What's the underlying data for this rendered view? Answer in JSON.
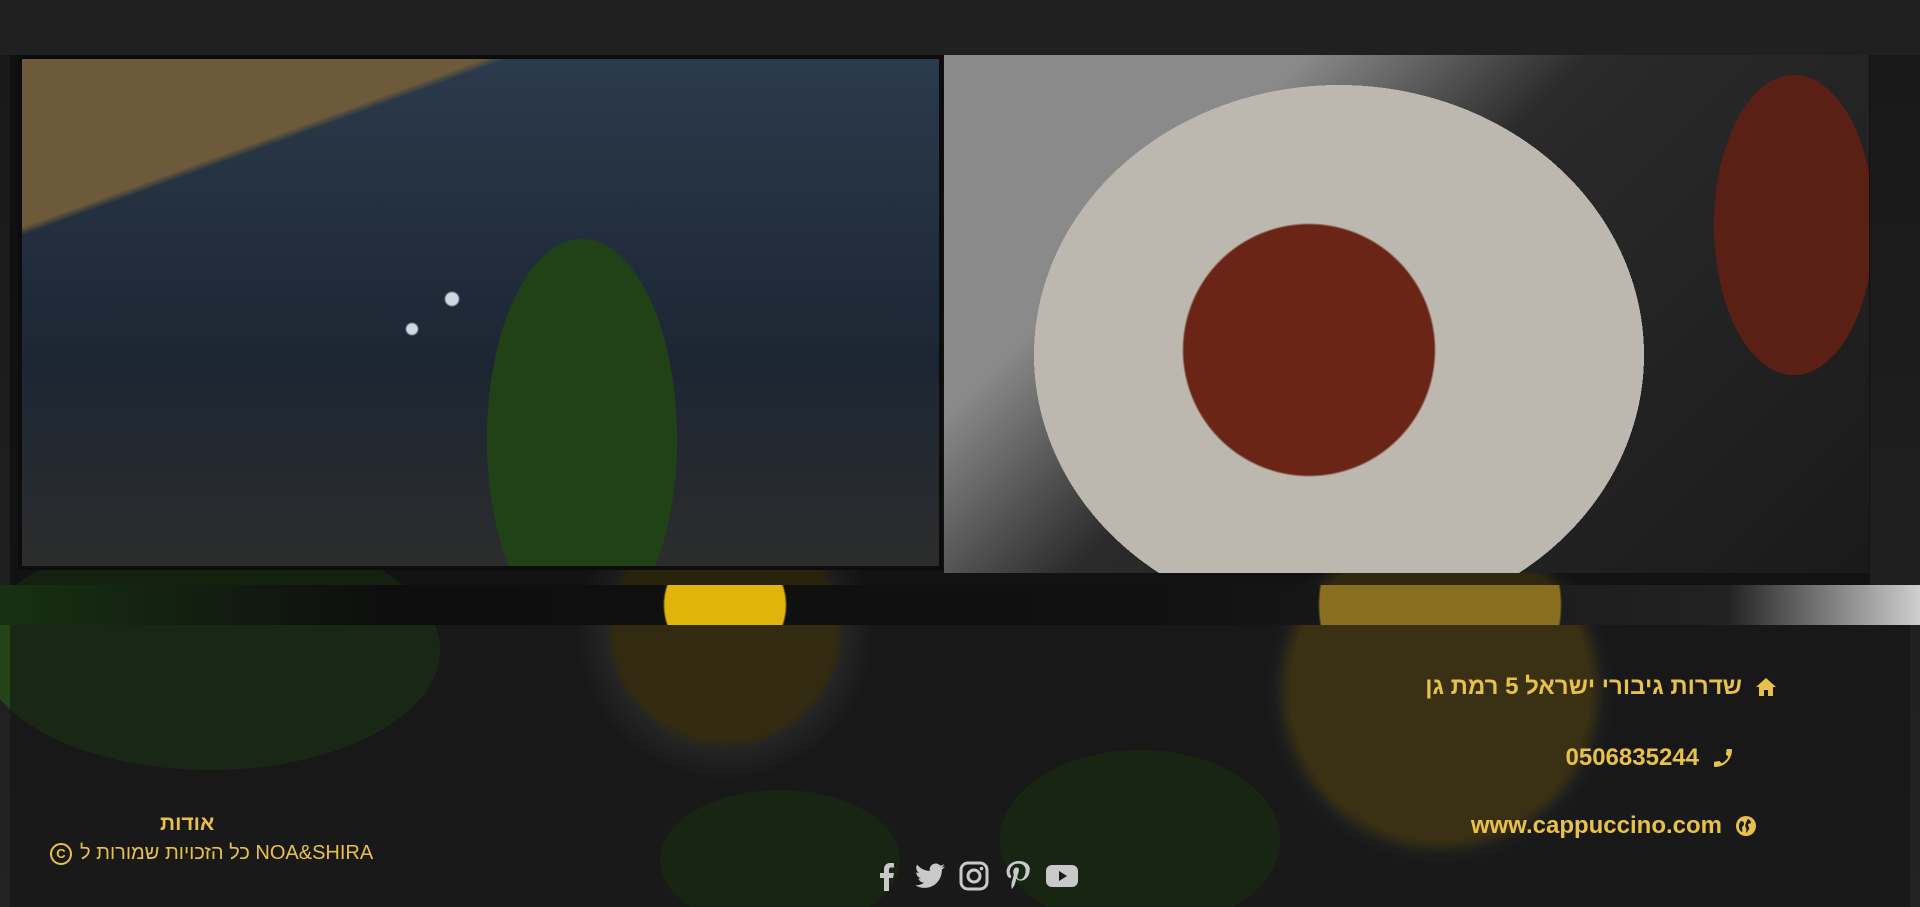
{
  "contact": {
    "address": "שדרות גיבורי ישראל 5 רמת גן",
    "phone": "0506835244",
    "website": "www.cappuccino.com"
  },
  "footer": {
    "about_label": "אודות",
    "copyright_text": "כל הזכויות שמורות ל NOA&SHIRA"
  },
  "icons": {
    "address": "home-icon",
    "phone": "phone-icon",
    "website": "globe-icon",
    "copyright": "copyright-icon",
    "social": [
      "facebook-icon",
      "twitter-icon",
      "instagram-icon",
      "pinterest-icon",
      "youtube-icon"
    ]
  },
  "colors": {
    "accent": "#e8c14a",
    "background": "#1b1b1b"
  }
}
